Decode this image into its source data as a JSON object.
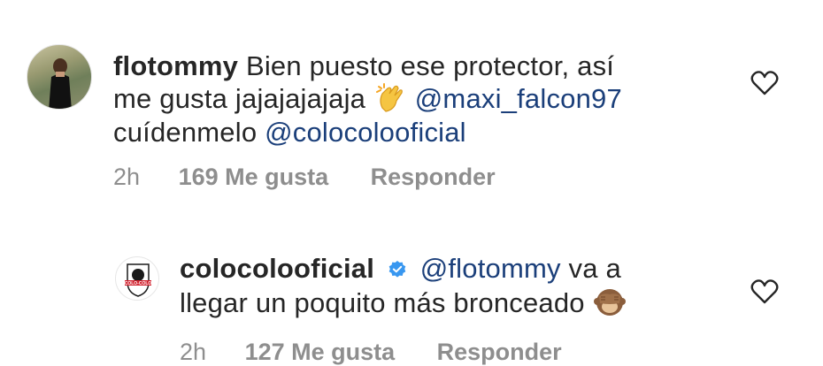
{
  "comments": [
    {
      "username": "flotommy",
      "text_line1": "Bien puesto ese protector, así",
      "text_line2": "me gusta jajajajajaja",
      "mention1": "@maxi_falcon97",
      "text_line3": "cuídenmelo",
      "mention2": "@colocolooficial",
      "time": "2h",
      "likes": "169 Me gusta",
      "reply": "Responder",
      "emoji": "clapping-hands"
    },
    {
      "username": "colocolooficial",
      "mention": "@flotommy",
      "text_line1_rest": "va a",
      "text_line2": "llegar un poquito más bronceado",
      "time": "2h",
      "likes": "127 Me gusta",
      "reply": "Responder",
      "verified": true,
      "emoji": "see-no-evil-monkey",
      "avatar_logo_text": "COLO-COLO"
    }
  ],
  "colors": {
    "text": "#262626",
    "meta": "#8e8e8e",
    "mention": "#1b3f7a",
    "verified": "#3897f0"
  }
}
